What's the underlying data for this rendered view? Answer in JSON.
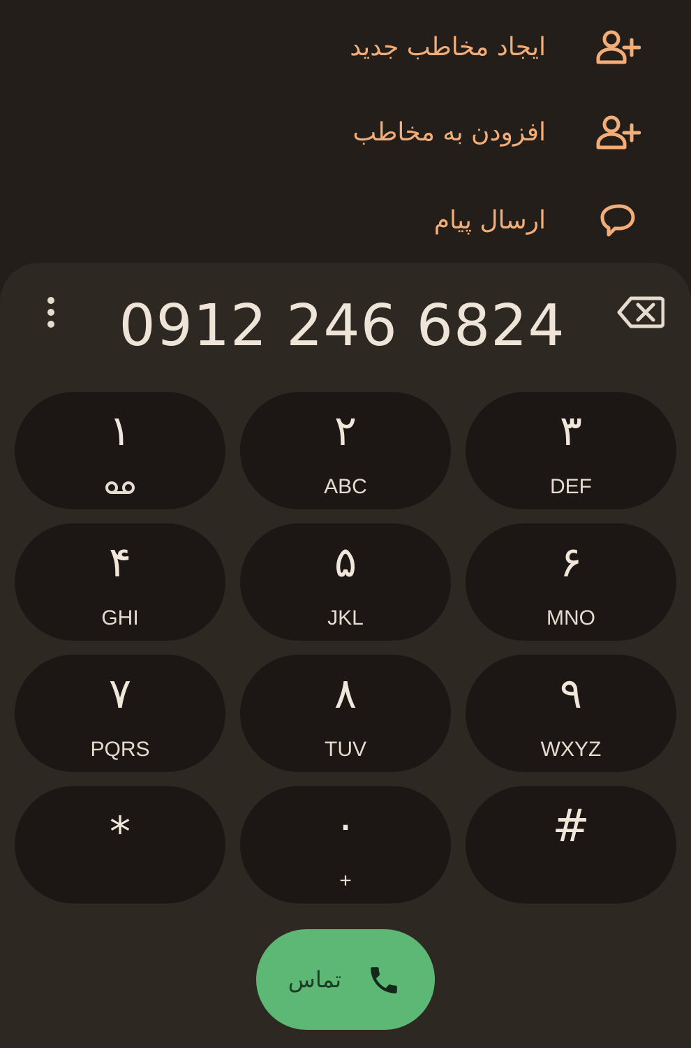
{
  "actions": [
    {
      "label": "ایجاد مخاطب جدید",
      "icon": "person-add-icon"
    },
    {
      "label": "افزودن به مخاطب",
      "icon": "person-add-icon"
    },
    {
      "label": "ارسال پیام",
      "icon": "message-icon"
    }
  ],
  "dialer": {
    "number": "0912 246 6824",
    "more_icon": "more-vert-icon",
    "backspace_icon": "backspace-icon"
  },
  "keys": [
    {
      "digit": "۱",
      "letters": "",
      "sub_icon": "voicemail-icon"
    },
    {
      "digit": "۲",
      "letters": "ABC"
    },
    {
      "digit": "۳",
      "letters": "DEF"
    },
    {
      "digit": "۴",
      "letters": "GHI"
    },
    {
      "digit": "۵",
      "letters": "JKL"
    },
    {
      "digit": "۶",
      "letters": "MNO"
    },
    {
      "digit": "۷",
      "letters": "PQRS"
    },
    {
      "digit": "۸",
      "letters": "TUV"
    },
    {
      "digit": "۹",
      "letters": "WXYZ"
    },
    {
      "digit": "*",
      "letters": ""
    },
    {
      "digit": "۰",
      "letters": "+"
    },
    {
      "digit": "#",
      "letters": ""
    }
  ],
  "call": {
    "label": "تماس",
    "icon": "phone-icon"
  },
  "colors": {
    "background": "#231e1a",
    "sheet": "#2e2823",
    "key": "#1c1714",
    "accent": "#f2ad78",
    "call": "#5cb874"
  }
}
